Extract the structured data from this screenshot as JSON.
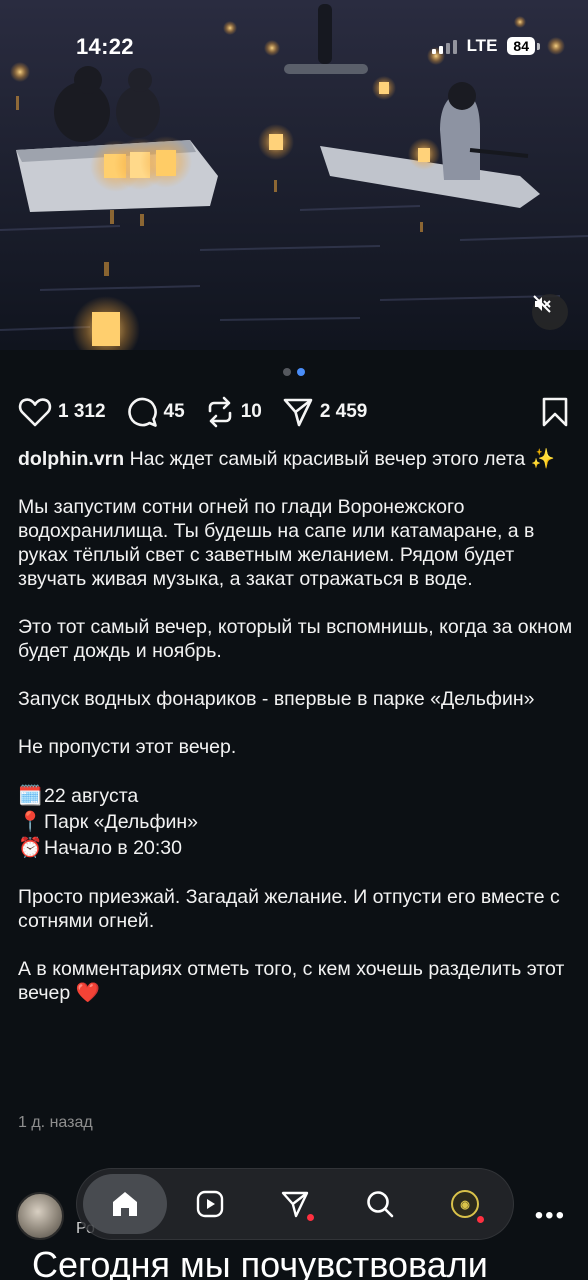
{
  "status_bar": {
    "time": "14:22",
    "network": "LTE",
    "battery": "84"
  },
  "media": {
    "description_icon": "speaker-muted-icon",
    "carousel": {
      "count": 2,
      "active": 2
    }
  },
  "actions": {
    "likes": "1 312",
    "comments": "45",
    "reposts": "10",
    "shares": "2 459"
  },
  "post": {
    "username": "dolphin.vrn",
    "caption_first": "Нас ждет самый красивый вечер этого лета ✨",
    "paragraph_1": "Мы запустим сотни огней по глади Воронежского водохранилища. Ты будешь на сапе или катамаране, а в руках тёплый свет с заветным желанием. Рядом будет звучать живая музыка, а закат отражаться в воде.",
    "paragraph_2": "Это тот самый вечер, который ты вспомнишь, когда за окном будет дождь и ноябрь.",
    "paragraph_3": "Запуск водных фонариков - впервые в парке «Дельфин»",
    "paragraph_4": "Не пропусти этот вечер.",
    "details": [
      {
        "emoji": "🗓️",
        "text": "22 августа"
      },
      {
        "emoji": "📍",
        "text": "Парк «Дельфин»"
      },
      {
        "emoji": "⏰",
        "text": "Начало в 20:30"
      }
    ],
    "paragraph_5": "Просто приезжай. Загадай желание. И отпусти его вместе с сотнями огней.",
    "paragraph_6": "А в комментариях отметь того, с кем хочешь разделить этот вечер ❤️",
    "time_ago": "1 д. назад"
  },
  "next_post": {
    "username_peek": "Ро",
    "more": "•••",
    "overlay_text": "Сегодня мы почувствовали"
  },
  "nav": {
    "items": [
      "home-icon",
      "reels-icon",
      "direct-icon",
      "search-icon",
      "profile-avatar"
    ],
    "active": "home-icon",
    "accent": "#ff3040"
  }
}
